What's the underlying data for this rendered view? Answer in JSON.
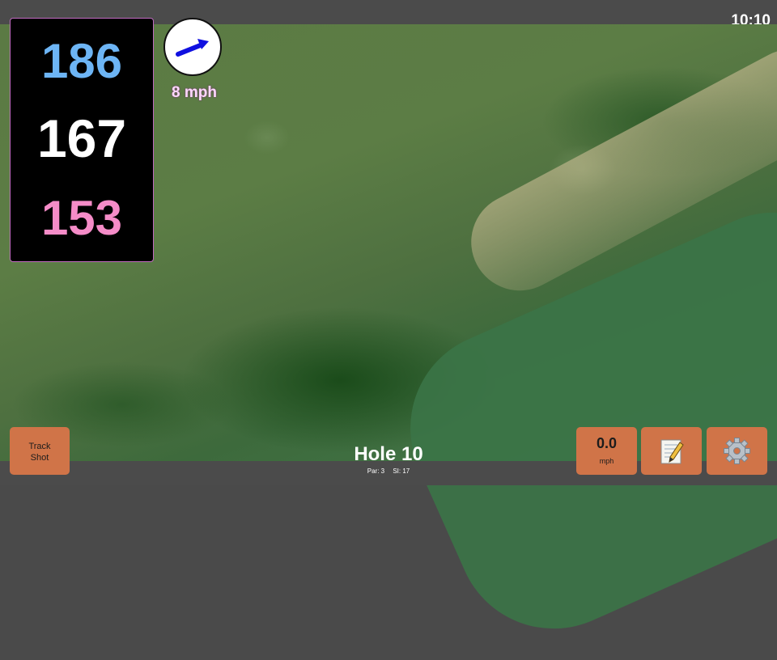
{
  "status_bar": {
    "time": "10:10"
  },
  "distances": {
    "back": "186",
    "middle": "167",
    "front": "153"
  },
  "wind": {
    "speed": "8 mph",
    "icon": "wind-arrow-icon"
  },
  "track_button": {
    "line1": "Track",
    "line2": "Shot"
  },
  "hole": {
    "title": "Hole 10",
    "par": "Par: 3",
    "si": "SI: 17"
  },
  "speed": {
    "value": "0.0",
    "unit": "mph"
  },
  "notes_button": {
    "icon": "notepad-icon"
  },
  "settings_button": {
    "icon": "gear-icon"
  },
  "colors": {
    "back": "#6db5f5",
    "middle": "#ffffff",
    "front": "#f58cc8",
    "button": "#d07448",
    "wind_arrow": "#1010e0"
  }
}
